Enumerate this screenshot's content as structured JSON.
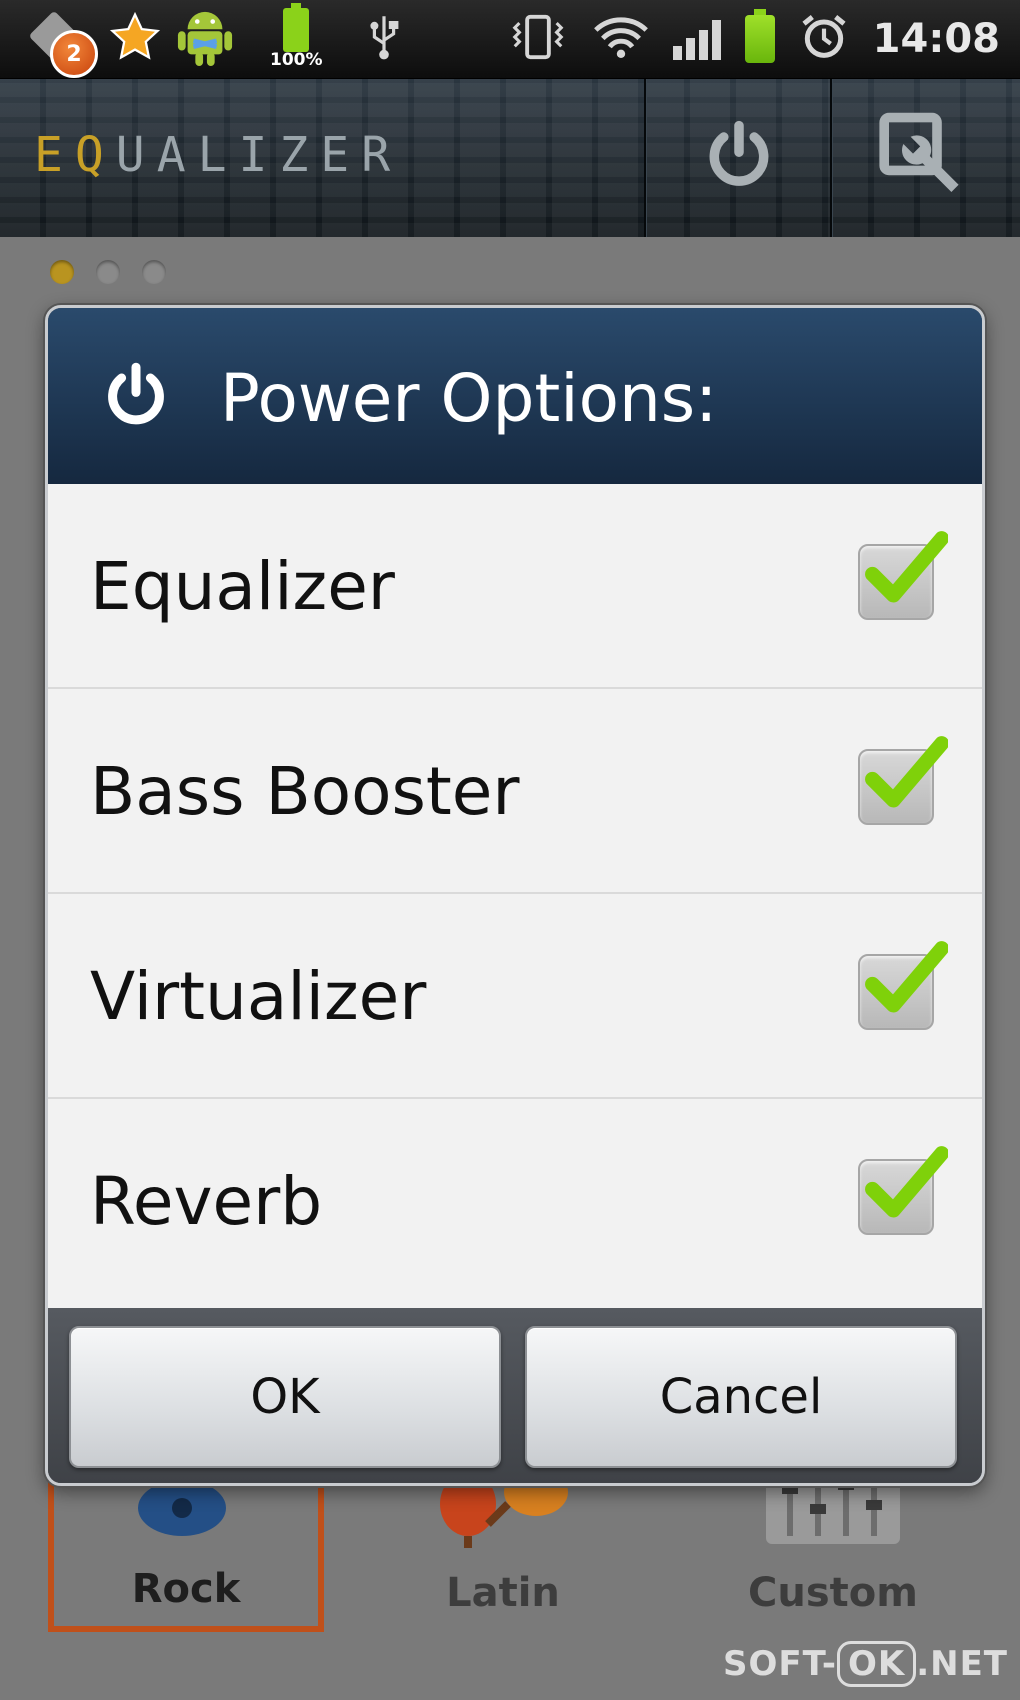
{
  "status_bar": {
    "notification_count": "2",
    "battery_percent": "100%",
    "time": "14:08",
    "icons": [
      "notification-icon",
      "star-icon",
      "android-icon",
      "usb-icon",
      "vibrate-icon",
      "wifi-icon",
      "signal-icon",
      "battery-icon",
      "alarm-icon"
    ]
  },
  "app_header": {
    "title_accent": "EQ",
    "title_rest": "UALIZER",
    "actions": [
      "power-icon",
      "settings-wrench-icon"
    ]
  },
  "pager": {
    "pages": 3,
    "active": 1
  },
  "presets": {
    "items": [
      {
        "label": "Rock",
        "selected": true
      },
      {
        "label": "Latin",
        "selected": false
      },
      {
        "label": "Custom",
        "selected": false
      }
    ]
  },
  "dialog": {
    "title": "Power Options:",
    "options": [
      {
        "label": "Equalizer",
        "checked": true
      },
      {
        "label": "Bass Booster",
        "checked": true
      },
      {
        "label": "Virtualizer",
        "checked": true
      },
      {
        "label": "Reverb",
        "checked": true
      }
    ],
    "ok_label": "OK",
    "cancel_label": "Cancel"
  },
  "watermark": {
    "left": "SOFT-",
    "middle": "OK",
    "right": ".NET"
  },
  "colors": {
    "dialog_header": "#1f3a5a",
    "check_green": "#7fd10a",
    "title_accent": "#c8a027",
    "selected_preset_border": "#c0501a"
  }
}
